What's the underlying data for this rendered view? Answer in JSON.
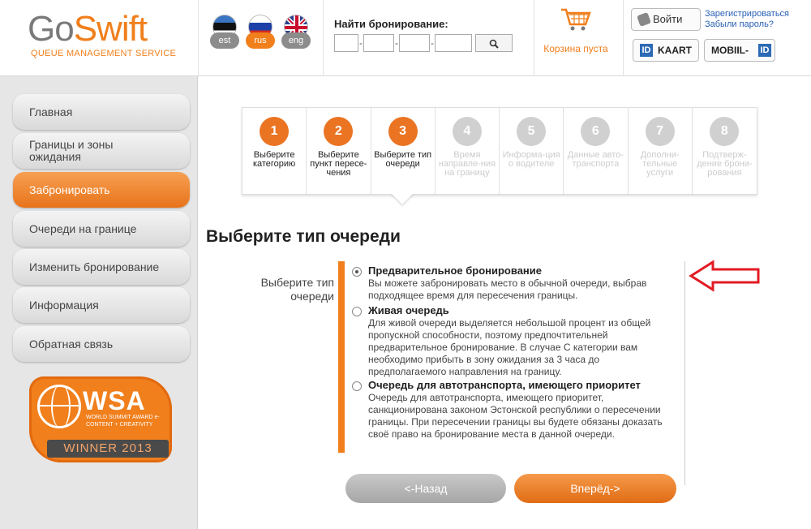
{
  "header": {
    "logo": {
      "go": "Go",
      "swift": "Swift",
      "subtitle": "QUEUE MANAGEMENT SERVICE"
    },
    "languages": [
      {
        "label": "est",
        "active": false
      },
      {
        "label": "rus",
        "active": true
      },
      {
        "label": "eng",
        "active": false
      }
    ],
    "search": {
      "label": "Найти бронирование:",
      "button_icon": "search-icon"
    },
    "cart": {
      "label": "Корзина пуста",
      "icon": "shopping-cart-icon"
    },
    "login": {
      "label": "Войти",
      "register": "Зарегистрироваться",
      "forgot": "Забыли пароль?"
    },
    "id_buttons": {
      "kaart": "KAART",
      "mobiil": "MOBIIL-"
    }
  },
  "sidebar": {
    "items": [
      {
        "label": "Главная",
        "active": false
      },
      {
        "label": "Границы и зоны ожидания",
        "active": false
      },
      {
        "label": "Забронировать",
        "active": true
      },
      {
        "label": "Очереди на границе",
        "active": false
      },
      {
        "label": "Изменить бронирование",
        "active": false
      },
      {
        "label": "Информация",
        "active": false
      },
      {
        "label": "Обратная связь",
        "active": false
      }
    ],
    "award": {
      "name": "WSA",
      "subtitle": "WORLD SUMMIT AWARD e-CONTENT + CREATIVITY",
      "winner": "WINNER 2013"
    }
  },
  "steps": [
    {
      "num": "1",
      "label": "Выберите категорию",
      "done": true
    },
    {
      "num": "2",
      "label": "Выберите пункт пересе-чения",
      "done": true
    },
    {
      "num": "3",
      "label": "Выберите тип очереди",
      "done": true
    },
    {
      "num": "4",
      "label": "Время направле-ния на границу",
      "done": false
    },
    {
      "num": "5",
      "label": "Информа-ция о водителе",
      "done": false
    },
    {
      "num": "6",
      "label": "Данные авто-транспорта",
      "done": false
    },
    {
      "num": "7",
      "label": "Дополни-тельные услуги",
      "done": false
    },
    {
      "num": "8",
      "label": "Подтверж-дение брони-рования",
      "done": false
    }
  ],
  "main": {
    "title": "Выберите тип очереди",
    "field_label": "Выберите тип очереди",
    "options": [
      {
        "title": "Предварительное бронирование",
        "desc": "Вы можете забронировать место в обычной очереди, выбрав подходящее время для пересечения границы.",
        "checked": true
      },
      {
        "title": "Живая очередь",
        "desc": "Для живой очереди выделяется небольшой процент из общей пропускной способности, поэтому предпочтительней предварительное бронирование. В случае С категории вам необходимо прибыть в зону ожидания за 3 часа до предполагаемого направления на границу.",
        "checked": false
      },
      {
        "title": "Очередь для автотранспорта, имеющего приоритет",
        "desc": "Очередь для автотранспорта, имеющего приоритет, санкционирована законом Эстонской республики о пересечении границы. При пересечении границы вы будете обязаны доказать своё право на бронирование места в данной очереди.",
        "checked": false
      }
    ],
    "back_label": "<-Назад",
    "next_label": "Вперёд->"
  },
  "colors": {
    "accent": "#f07f1c",
    "link": "#2860b5",
    "arrow": "#e31b23"
  }
}
